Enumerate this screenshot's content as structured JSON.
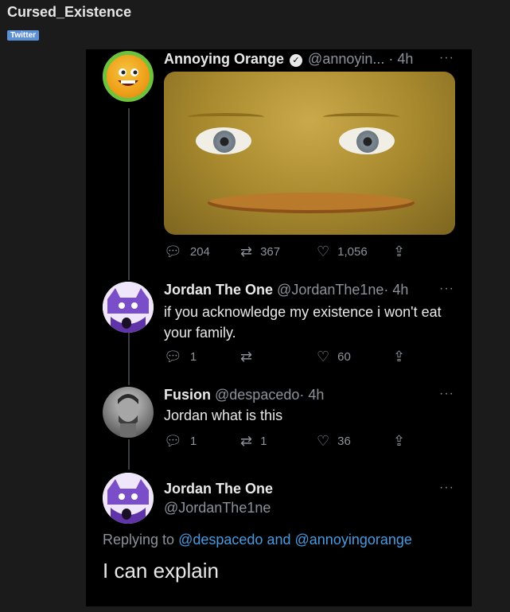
{
  "post": {
    "title": "Cursed_Existence",
    "flair": "Twitter"
  },
  "tweets": [
    {
      "name": "Annoying Orange",
      "handle": "@annoyin...",
      "time": "· 4h",
      "more": "···",
      "stats": {
        "replies": "204",
        "retweets": "367",
        "likes": "1,056"
      }
    },
    {
      "name": "Jordan The One",
      "handle": "@JordanThe1ne",
      "time": "· 4h",
      "more": "···",
      "text": "if you acknowledge my existence i won't eat your family.",
      "stats": {
        "replies": "1",
        "retweets": "",
        "likes": "60"
      }
    },
    {
      "name": "Fusion",
      "handle": "@despacedo",
      "time": "· 4h",
      "more": "···",
      "text": "Jordan what is this",
      "stats": {
        "replies": "1",
        "retweets": "1",
        "likes": "36"
      }
    }
  ],
  "main_tweet": {
    "name": "Jordan The One",
    "handle": "@JordanThe1ne",
    "more": "···",
    "replying_prefix": "Replying to",
    "replying_user1": "@despacedo",
    "replying_and": "and",
    "replying_user2": "@annoyingorange",
    "text": "I can explain"
  },
  "icons": [
    "reply-icon",
    "retweet-icon",
    "like-icon",
    "share-icon",
    "verified-icon",
    "more-icon"
  ],
  "colors": {
    "link": "#4a9be0",
    "muted": "#8b9299",
    "flair": "#5b8fd6"
  }
}
